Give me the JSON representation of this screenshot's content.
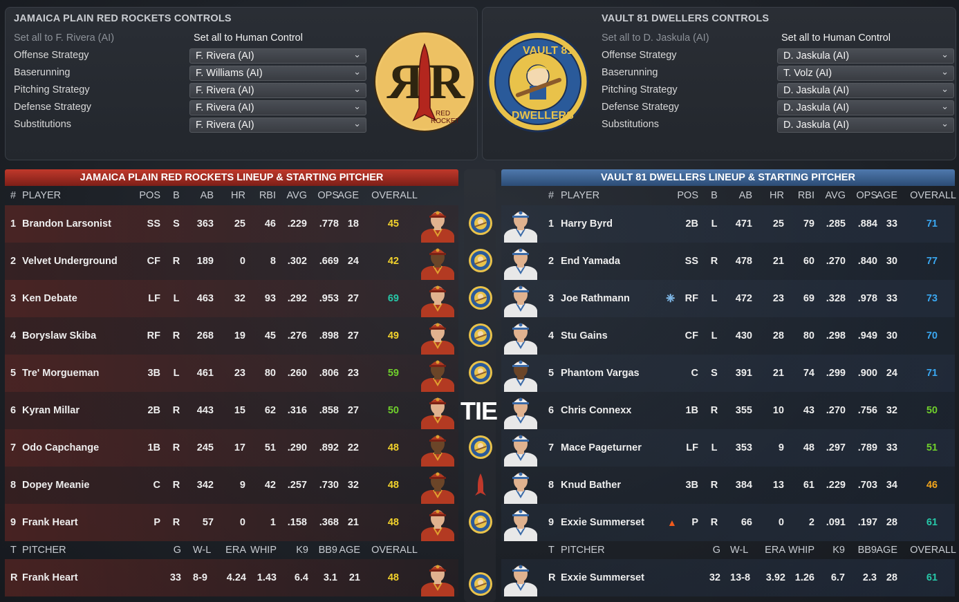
{
  "home_controls": {
    "title": "JAMAICA PLAIN RED ROCKETS CONTROLS",
    "set_all_ai": "Set all to F. Rivera (AI)",
    "set_all_human": "Set all to Human Control",
    "rows": [
      {
        "label": "Offense Strategy",
        "value": "F. Rivera (AI)"
      },
      {
        "label": "Baserunning",
        "value": "F. Williams (AI)"
      },
      {
        "label": "Pitching Strategy",
        "value": "F. Rivera (AI)"
      },
      {
        "label": "Defense Strategy",
        "value": "F. Rivera (AI)"
      },
      {
        "label": "Substitutions",
        "value": "F. Rivera (AI)"
      }
    ],
    "logo_text": [
      "RED",
      "ROCKET"
    ]
  },
  "away_controls": {
    "title": "VAULT 81 DWELLERS CONTROLS",
    "set_all_ai": "Set all to D. Jaskula (AI)",
    "set_all_human": "Set all to Human Control",
    "rows": [
      {
        "label": "Offense Strategy",
        "value": "D. Jaskula (AI)"
      },
      {
        "label": "Baserunning",
        "value": "T. Volz (AI)"
      },
      {
        "label": "Pitching Strategy",
        "value": "D. Jaskula (AI)"
      },
      {
        "label": "Defense Strategy",
        "value": "D. Jaskula (AI)"
      },
      {
        "label": "Substitutions",
        "value": "D. Jaskula (AI)"
      }
    ],
    "logo_text": [
      "VAULT 81",
      "DWELLERS"
    ]
  },
  "home_lineup": {
    "title": "JAMAICA PLAIN RED ROCKETS LINEUP & STARTING PITCHER",
    "columns": [
      "#",
      "PLAYER",
      "POS",
      "B",
      "AB",
      "HR",
      "RBI",
      "AVG",
      "OPS",
      "AGE",
      "OVERALL"
    ],
    "players": [
      {
        "num": "1",
        "name": "Brandon Larsonist",
        "pos": "SS",
        "b": "S",
        "ab": "363",
        "hr": "25",
        "rbi": "46",
        "avg": ".229",
        "ops": ".778",
        "age": "18",
        "ovr": "45"
      },
      {
        "num": "2",
        "name": "Velvet Underground",
        "pos": "CF",
        "b": "R",
        "ab": "189",
        "hr": "0",
        "rbi": "8",
        "avg": ".302",
        "ops": ".669",
        "age": "24",
        "ovr": "42"
      },
      {
        "num": "3",
        "name": "Ken Debate",
        "pos": "LF",
        "b": "L",
        "ab": "463",
        "hr": "32",
        "rbi": "93",
        "avg": ".292",
        "ops": ".953",
        "age": "27",
        "ovr": "69"
      },
      {
        "num": "4",
        "name": "Boryslaw Skiba",
        "pos": "RF",
        "b": "R",
        "ab": "268",
        "hr": "19",
        "rbi": "45",
        "avg": ".276",
        "ops": ".898",
        "age": "27",
        "ovr": "49"
      },
      {
        "num": "5",
        "name": "Tre' Morgueman",
        "pos": "3B",
        "b": "L",
        "ab": "461",
        "hr": "23",
        "rbi": "80",
        "avg": ".260",
        "ops": ".806",
        "age": "23",
        "ovr": "59"
      },
      {
        "num": "6",
        "name": "Kyran Millar",
        "pos": "2B",
        "b": "R",
        "ab": "443",
        "hr": "15",
        "rbi": "62",
        "avg": ".316",
        "ops": ".858",
        "age": "27",
        "ovr": "50"
      },
      {
        "num": "7",
        "name": "Odo Capchange",
        "pos": "1B",
        "b": "R",
        "ab": "245",
        "hr": "17",
        "rbi": "51",
        "avg": ".290",
        "ops": ".892",
        "age": "22",
        "ovr": "48"
      },
      {
        "num": "8",
        "name": "Dopey Meanie",
        "pos": "C",
        "b": "R",
        "ab": "342",
        "hr": "9",
        "rbi": "42",
        "avg": ".257",
        "ops": ".730",
        "age": "32",
        "ovr": "48"
      },
      {
        "num": "9",
        "name": "Frank Heart",
        "pos": "P",
        "b": "R",
        "ab": "57",
        "hr": "0",
        "rbi": "1",
        "avg": ".158",
        "ops": ".368",
        "age": "21",
        "ovr": "48"
      }
    ],
    "pitcher_columns": [
      "T",
      "PITCHER",
      "G",
      "W-L",
      "ERA",
      "WHIP",
      "K9",
      "BB9",
      "AGE",
      "OVERALL"
    ],
    "pitcher": {
      "t": "R",
      "name": "Frank Heart",
      "g": "33",
      "wl": "8-9",
      "era": "4.24",
      "whip": "1.43",
      "k9": "6.4",
      "bb9": "3.1",
      "age": "21",
      "ovr": "48"
    }
  },
  "away_lineup": {
    "title": "VAULT 81 DWELLERS LINEUP & STARTING PITCHER",
    "columns": [
      "#",
      "PLAYER",
      "POS",
      "B",
      "AB",
      "HR",
      "RBI",
      "AVG",
      "OPS",
      "AGE",
      "OVERALL"
    ],
    "players": [
      {
        "num": "1",
        "name": "Harry Byrd",
        "pos": "2B",
        "b": "L",
        "ab": "471",
        "hr": "25",
        "rbi": "79",
        "avg": ".285",
        "ops": ".884",
        "age": "33",
        "ovr": "71"
      },
      {
        "num": "2",
        "name": "End Yamada",
        "pos": "SS",
        "b": "R",
        "ab": "478",
        "hr": "21",
        "rbi": "60",
        "avg": ".270",
        "ops": ".840",
        "age": "30",
        "ovr": "77"
      },
      {
        "num": "3",
        "name": "Joe Rathmann",
        "pos": "RF",
        "b": "L",
        "ab": "472",
        "hr": "23",
        "rbi": "69",
        "avg": ".328",
        "ops": ".978",
        "age": "33",
        "ovr": "73"
      },
      {
        "num": "4",
        "name": "Stu Gains",
        "pos": "CF",
        "b": "L",
        "ab": "430",
        "hr": "28",
        "rbi": "80",
        "avg": ".298",
        "ops": ".949",
        "age": "30",
        "ovr": "70"
      },
      {
        "num": "5",
        "name": "Phantom Vargas",
        "pos": "C",
        "b": "S",
        "ab": "391",
        "hr": "21",
        "rbi": "74",
        "avg": ".299",
        "ops": ".900",
        "age": "24",
        "ovr": "71"
      },
      {
        "num": "6",
        "name": "Chris Connexx",
        "pos": "1B",
        "b": "R",
        "ab": "355",
        "hr": "10",
        "rbi": "43",
        "avg": ".270",
        "ops": ".756",
        "age": "32",
        "ovr": "50"
      },
      {
        "num": "7",
        "name": "Mace Pageturner",
        "pos": "LF",
        "b": "L",
        "ab": "353",
        "hr": "9",
        "rbi": "48",
        "avg": ".297",
        "ops": ".789",
        "age": "33",
        "ovr": "51"
      },
      {
        "num": "8",
        "name": "Knud Bather",
        "pos": "3B",
        "b": "R",
        "ab": "384",
        "hr": "13",
        "rbi": "61",
        "avg": ".229",
        "ops": ".703",
        "age": "34",
        "ovr": "46"
      },
      {
        "num": "9",
        "name": "Exxie Summerset",
        "pos": "P",
        "b": "R",
        "ab": "66",
        "hr": "0",
        "rbi": "2",
        "avg": ".091",
        "ops": ".197",
        "age": "28",
        "ovr": "61"
      }
    ],
    "pitcher_columns": [
      "T",
      "PITCHER",
      "G",
      "W-L",
      "ERA",
      "WHIP",
      "K9",
      "BB9",
      "AGE",
      "OVERALL"
    ],
    "pitcher": {
      "t": "R",
      "name": "Exxie Summerset",
      "g": "32",
      "wl": "13-8",
      "era": "3.92",
      "whip": "1.26",
      "k9": "6.7",
      "bb9": "2.3",
      "age": "28",
      "ovr": "61"
    }
  },
  "matchup": {
    "label": "TIE"
  },
  "colors": {
    "home_header": "#c0392b",
    "away_header": "#4f79ad",
    "ovr_yellow": "#f2d22c",
    "ovr_green": "#6fcf2c",
    "ovr_teal": "#27c7a8",
    "ovr_blue": "#3aa7f0",
    "ovr_orange": "#f2a51c"
  }
}
